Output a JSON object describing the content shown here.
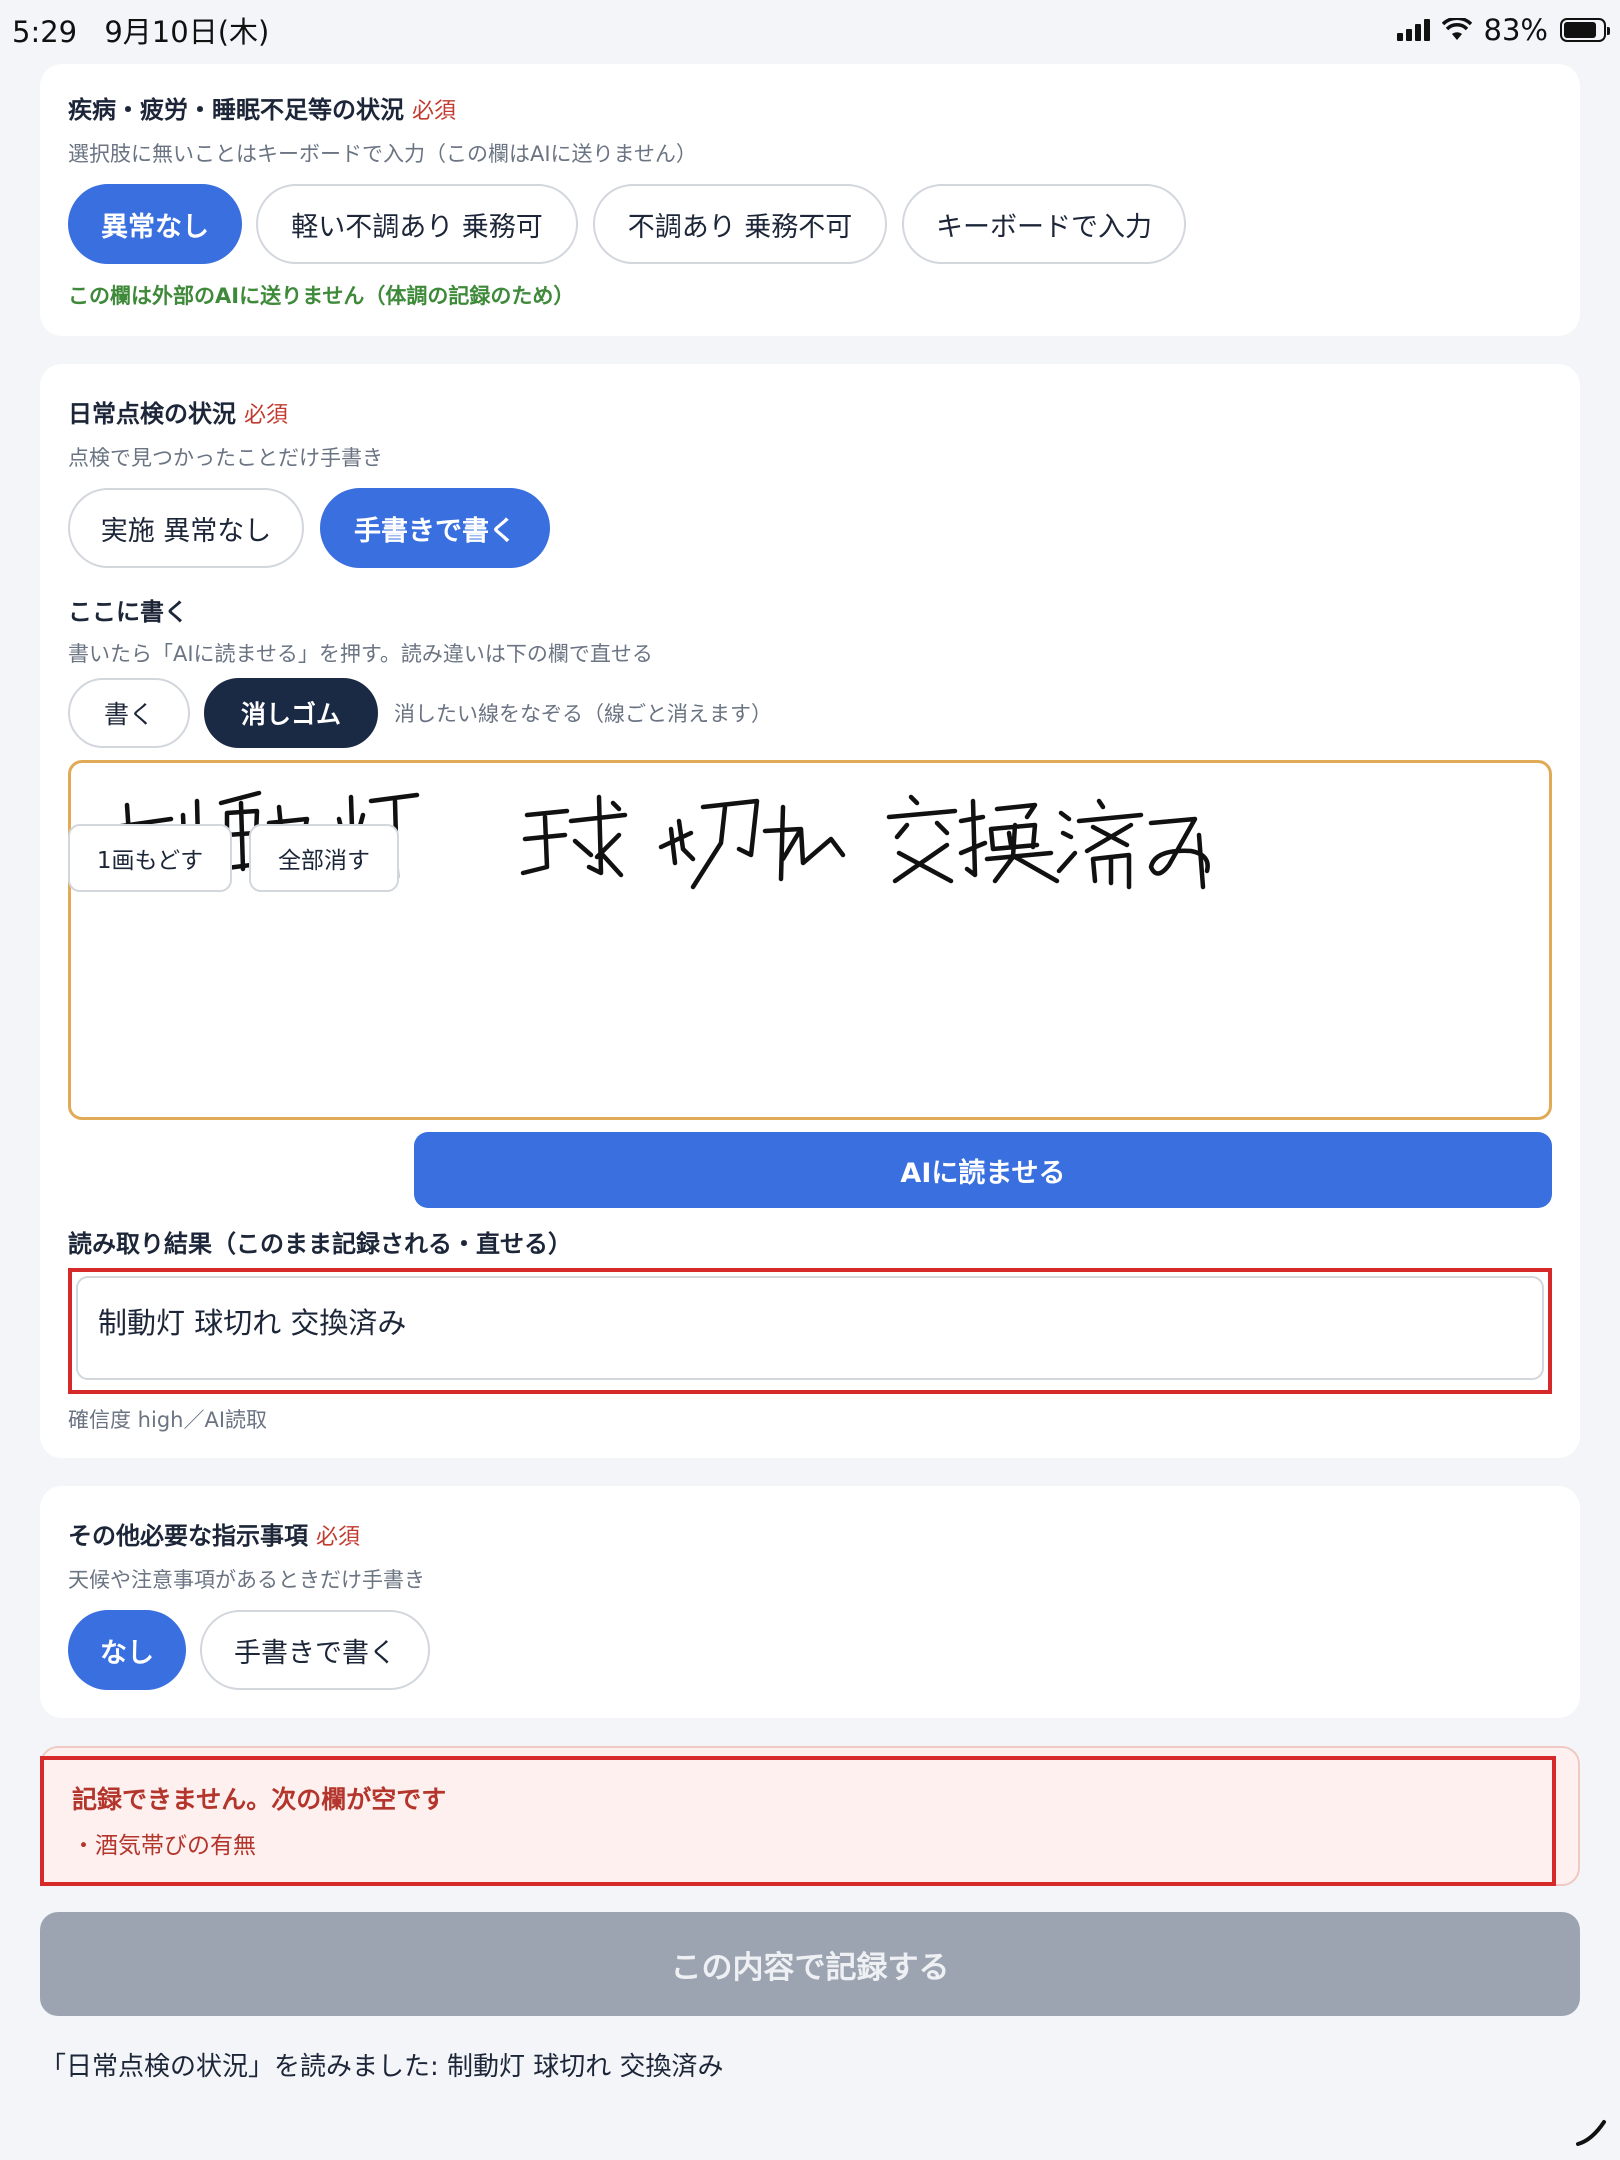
{
  "status_bar": {
    "time": "5:29",
    "date": "9月10日(木)",
    "battery": "83%"
  },
  "section1": {
    "label": "疾病・疲労・睡眠不足等の状況",
    "required": "必須",
    "hint": "選択肢に無いことはキーボードで入力（この欄はAIに送りません）",
    "options": [
      "異常なし",
      "軽い不調あり 乗務可",
      "不調あり 乗務不可",
      "キーボードで入力"
    ],
    "selected": "異常なし",
    "note": "この欄は外部のAIに送りません（体調の記録のため）"
  },
  "section2": {
    "label": "日常点検の状況",
    "required": "必須",
    "hint": "点検で見つかったことだけ手書き",
    "options": [
      "実施 異常なし",
      "手書きで書く"
    ],
    "selected": "手書きで書く",
    "canvas_label": "ここに書く",
    "canvas_hint": "書いたら「AIに読ませる」を押す。読み違いは下の欄で直せる",
    "tools": [
      "書く",
      "消しゴム"
    ],
    "active_tool": "消しゴム",
    "tool_hint": "消したい線をなぞる（線ごと消えます）",
    "undo": "1画もどす",
    "clear": "全部消す",
    "ai_read": "AIに読ませる",
    "result_label": "読み取り結果（このまま記録される・直せる）",
    "result_value": "制動灯 球切れ 交換済み",
    "confidence": "確信度 high／AI読取"
  },
  "section3": {
    "label": "その他必要な指示事項",
    "required": "必須",
    "hint": "天候や注意事項があるときだけ手書き",
    "options": [
      "なし",
      "手書きで書く"
    ],
    "selected": "なし"
  },
  "error": {
    "title": "記録できません。次の欄が空です",
    "item": "・酒気帯びの有無"
  },
  "submit": "この内容で記録する",
  "footer_message": "「日常点検の状況」を読みました: 制動灯 球切れ 交換済み",
  "colors": {
    "accent": "#3a6fe0",
    "dark": "#1b2a44",
    "error": "#d62a2a",
    "disabled": "#9ca4b1"
  }
}
